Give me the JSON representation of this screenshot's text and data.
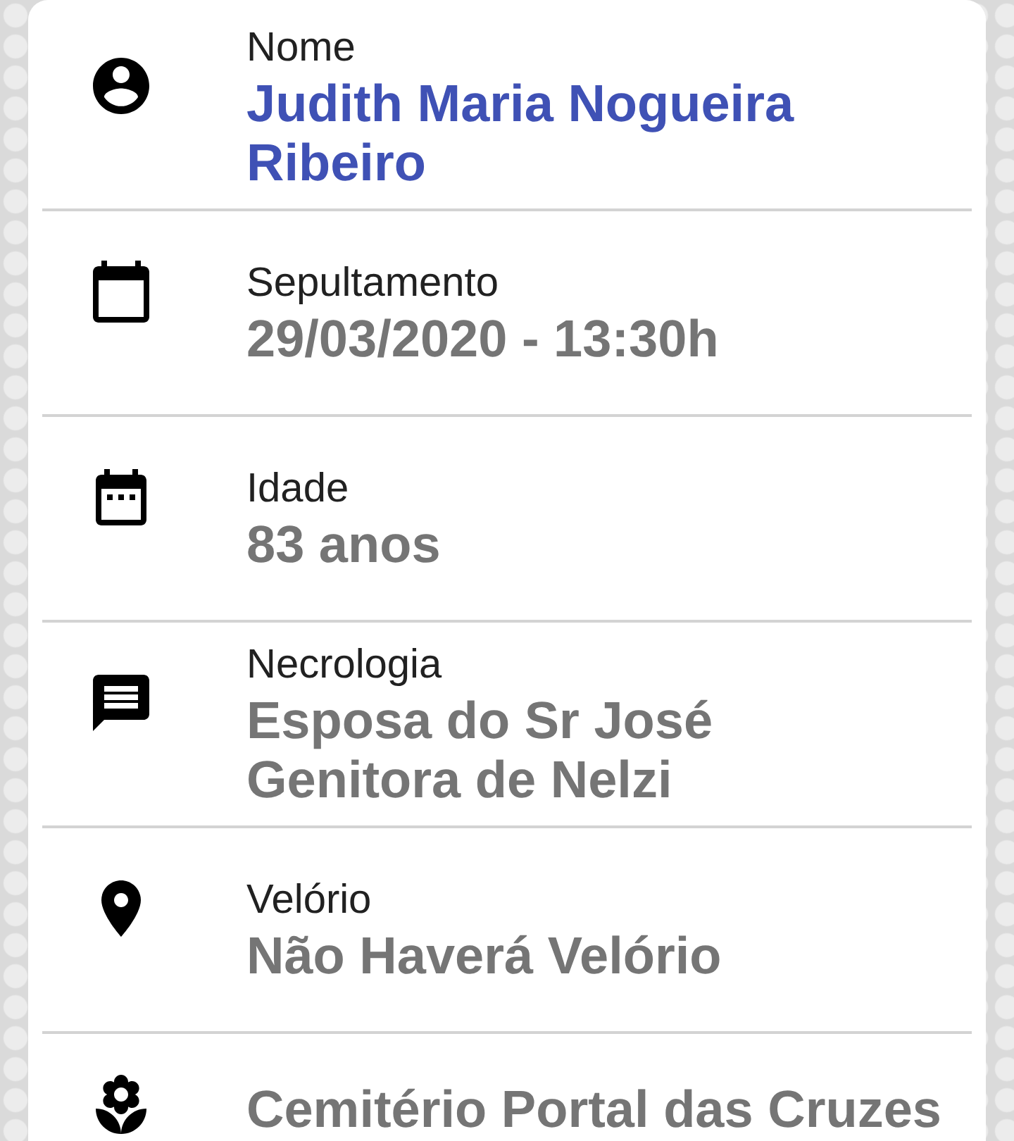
{
  "fields": [
    {
      "label": "Nome",
      "value_lines": [
        "Judith Maria Nogueira",
        "Ribeiro"
      ],
      "highlighted": true
    },
    {
      "label": "Sepultamento",
      "value_lines": [
        "29/03/2020 - 13:30h"
      ],
      "highlighted": false
    },
    {
      "label": "Idade",
      "value_lines": [
        "83 anos"
      ],
      "highlighted": false
    },
    {
      "label": "Necrologia",
      "value_lines": [
        "Esposa do Sr José",
        "Genitora de Nelzi"
      ],
      "highlighted": false
    },
    {
      "label": "Velório",
      "value_lines": [
        "Não Haverá Velório"
      ],
      "highlighted": false
    },
    {
      "value_lines": [
        "Cemitério Portal das Cruzes"
      ],
      "highlighted": false
    }
  ]
}
